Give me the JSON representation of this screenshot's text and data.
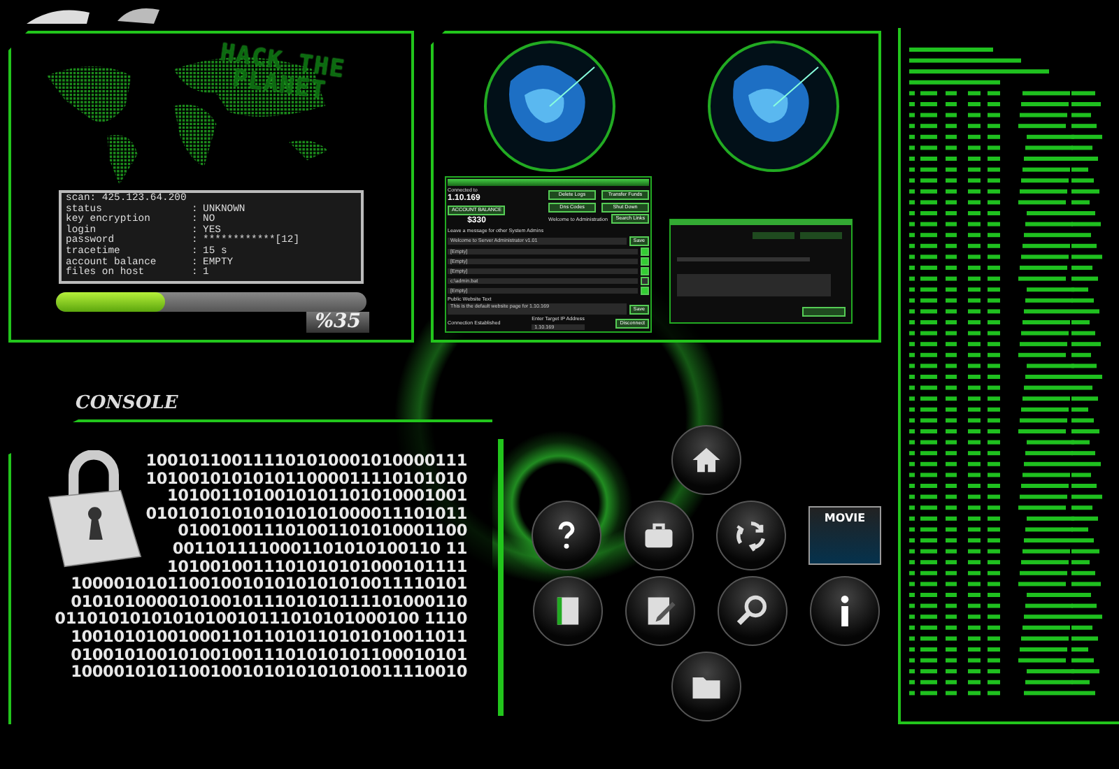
{
  "map_panel": {
    "banner_lines": [
      "HACK THE",
      "PLANET"
    ]
  },
  "scan": {
    "header": "scan: 425.123.64.200",
    "separator": ":",
    "rows": [
      {
        "label": "status",
        "value": "UNKNOWN"
      },
      {
        "label": "key encryption",
        "value": "NO"
      },
      {
        "label": "login",
        "value": "YES"
      },
      {
        "label": "password",
        "value": "************[12]"
      },
      {
        "label": "tracetime",
        "value": "15 s"
      },
      {
        "label": "account balance",
        "value": "EMPTY"
      },
      {
        "label": "files on host",
        "value": "1"
      }
    ]
  },
  "progress": {
    "level": 0.35,
    "label": "%35"
  },
  "admin_window": {
    "connected_label": "Connected to",
    "host": "1.10.169",
    "balance_label": "ACCOUNT BALANCE",
    "balance": "$330",
    "actions": [
      "Delete Logs",
      "Transfer Funds",
      "Dns Codes",
      "Shut Down"
    ],
    "welcome": "Welcome to Administration",
    "search": "Search Links",
    "message_label": "Leave a message for other System Admins",
    "message": "Welcome to Server Administrator v1.01",
    "save": "Save",
    "files": [
      {
        "name": "[Empty]",
        "checked": true
      },
      {
        "name": "[Empty]",
        "checked": true
      },
      {
        "name": "[Empty]",
        "checked": true
      },
      {
        "name": "c:\\admin.bat",
        "checked": false
      },
      {
        "name": "[Empty]",
        "checked": true
      }
    ],
    "public_label": "Public Website Text",
    "public_text": "This is the default website page for 1.10.169",
    "save2": "Save",
    "status": "Connection Established",
    "target_label": "Enter Target IP Address",
    "target": "1.10.169",
    "disconnect": "Disconnect"
  },
  "console": {
    "title": "CONSOLE",
    "lines": [
      "100101100111101010001010000111",
      "101001010101011000011110101010",
      "1010011010010101101010001001",
      "010101010101010101000011101011",
      "010010011101001101010001100",
      "0011011110001101010100110 11",
      "1010010011101010101000101111",
      "1000010101100100101010101010011110101",
      "0101010000101001011101010111101000110",
      "0110101010101010010111010101000100 1110",
      "1001010100100011011010110101010011011",
      "0100101001010010011101010101100010101",
      "1000010101100100101010101010011110010"
    ]
  },
  "launcher": {
    "rows": [
      [
        {
          "kind": "home"
        }
      ],
      [
        {
          "kind": "help"
        },
        {
          "kind": "briefcase"
        },
        {
          "kind": "recycle"
        },
        {
          "kind": "movie",
          "label": "MOVIE"
        }
      ],
      [
        {
          "kind": "book"
        },
        {
          "kind": "edit"
        },
        {
          "kind": "search"
        },
        {
          "kind": "info"
        }
      ],
      [
        {
          "kind": "folder"
        }
      ]
    ]
  }
}
